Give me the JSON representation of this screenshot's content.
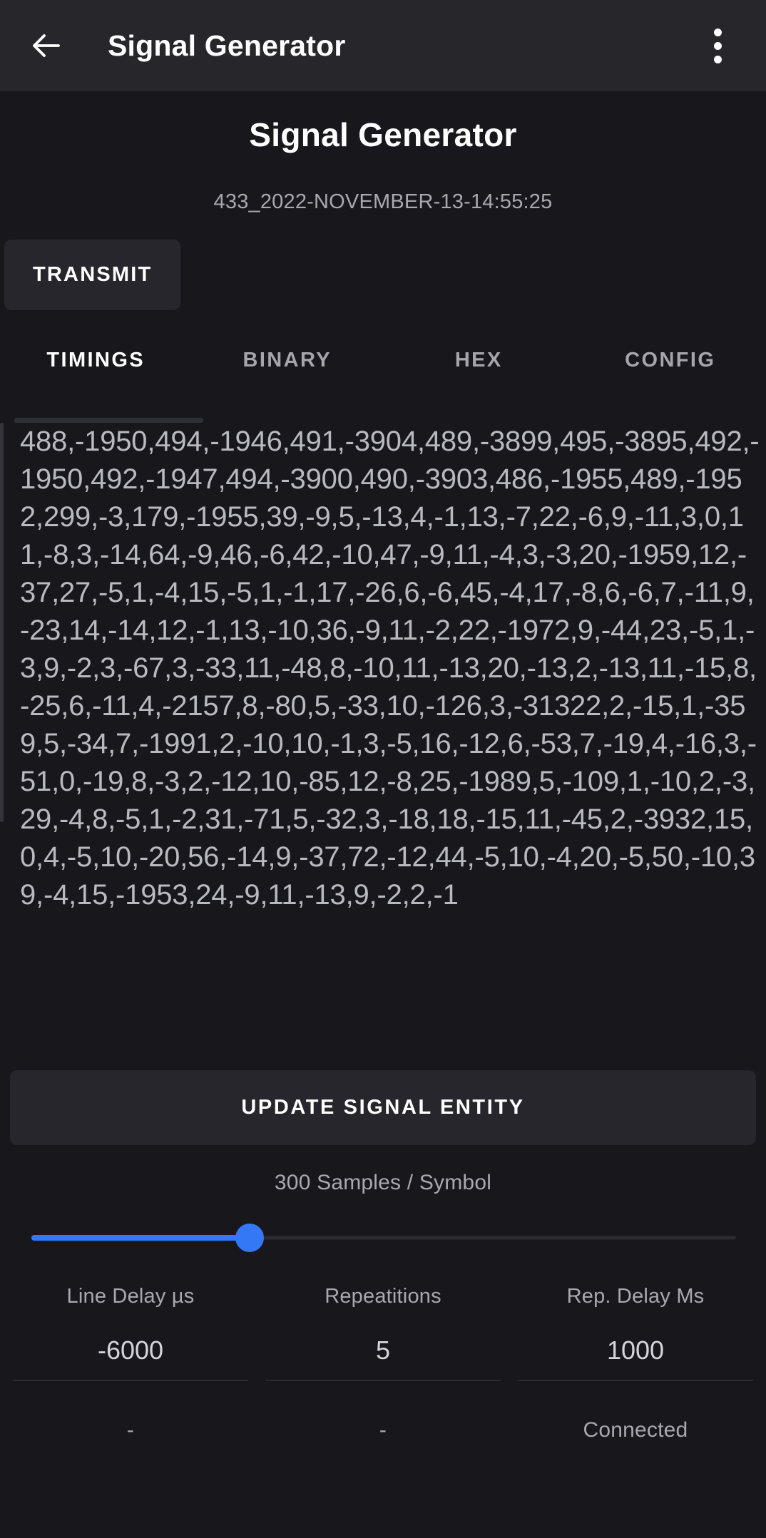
{
  "appbar": {
    "back_icon": "arrow-left-icon",
    "title": "Signal Generator",
    "overflow_icon": "more-vertical-icon"
  },
  "header": {
    "title": "Signal Generator",
    "subtitle": "433_2022-NOVEMBER-13-14:55:25"
  },
  "actions": {
    "transmit_label": "TRANSMIT",
    "update_label": "UPDATE SIGNAL ENTITY"
  },
  "tabs": [
    {
      "label": "TIMINGS",
      "active": true
    },
    {
      "label": "BINARY",
      "active": false
    },
    {
      "label": "HEX",
      "active": false
    },
    {
      "label": "CONFIG",
      "active": false
    }
  ],
  "timings": {
    "text": "488,-1950,494,-1946,491,-3904,489,-3899,495,-3895,492,-1950,492,-1947,494,-3900,490,-3903,486,-1955,489,-1952,299,-3,179,-1955,39,-9,5,-13,4,-1,13,-7,22,-6,9,-11,3,0,11,-8,3,-14,64,-9,46,-6,42,-10,47,-9,11,-4,3,-3,20,-1959,12,-37,27,-5,1,-4,15,-5,1,-1,17,-26,6,-6,45,-4,17,-8,6,-6,7,-11,9,-23,14,-14,12,-1,13,-10,36,-9,11,-2,22,-1972,9,-44,23,-5,1,-3,9,-2,3,-67,3,-33,11,-48,8,-10,11,-13,20,-13,2,-13,11,-15,8,-25,6,-11,4,-2157,8,-80,5,-33,10,-126,3,-31322,2,-15,1,-359,5,-34,7,-1991,2,-10,10,-1,3,-5,16,-12,6,-53,7,-19,4,-16,3,-51,0,-19,8,-3,2,-12,10,-85,12,-8,25,-1989,5,-109,1,-10,2,-3,29,-4,8,-5,1,-2,31,-71,5,-32,3,-18,18,-15,11,-45,2,-3932,15,0,4,-5,10,-20,56,-14,9,-37,72,-12,44,-5,10,-4,20,-5,50,-10,39,-4,15,-1953,24,-9,11,-13,9,-2,2,-1"
  },
  "slider": {
    "label": "300 Samples / Symbol",
    "percent": 31,
    "accent_color": "#3478f6"
  },
  "fields": [
    {
      "label": "Line Delay µs",
      "value": "-6000",
      "status": "-"
    },
    {
      "label": "Repeatitions",
      "value": "5",
      "status": "-"
    },
    {
      "label": "Rep. Delay Ms",
      "value": "1000",
      "status": "Connected"
    }
  ],
  "colors": {
    "appbar_bg": "#26262b",
    "page_bg": "#17171c",
    "button_bg": "#26262c",
    "accent": "#3478f6"
  }
}
